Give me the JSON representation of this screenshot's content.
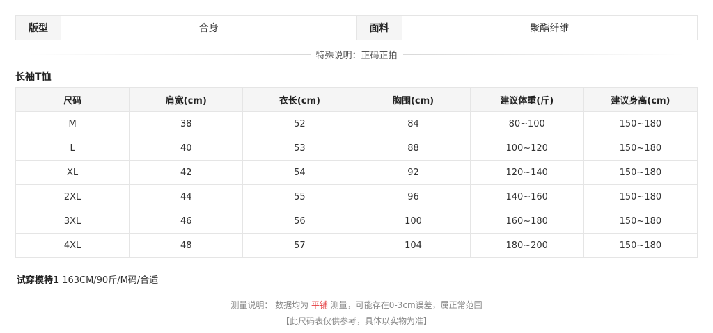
{
  "attributes": {
    "fit_label": "版型",
    "fit_value": "合身",
    "fabric_label": "面料",
    "fabric_value": "聚酯纤维"
  },
  "special_note": "特殊说明：正码正拍",
  "section_title": "长袖T恤",
  "size_table": {
    "headers": [
      "尺码",
      "肩宽(cm)",
      "衣长(cm)",
      "胸围(cm)",
      "建议体重(斤)",
      "建议身高(cm)"
    ],
    "rows": [
      [
        "M",
        "38",
        "52",
        "84",
        "80~100",
        "150~180"
      ],
      [
        "L",
        "40",
        "53",
        "88",
        "100~120",
        "150~180"
      ],
      [
        "XL",
        "42",
        "54",
        "92",
        "120~140",
        "150~180"
      ],
      [
        "2XL",
        "44",
        "55",
        "96",
        "140~160",
        "150~180"
      ],
      [
        "3XL",
        "46",
        "56",
        "100",
        "160~180",
        "150~180"
      ],
      [
        "4XL",
        "48",
        "57",
        "104",
        "180~200",
        "150~180"
      ]
    ]
  },
  "model": {
    "label": "试穿模特1",
    "value": " 163CM/90斤/M码/合适"
  },
  "footer": {
    "measure_prefix": "测量说明：  数据均为 ",
    "measure_highlight": "平铺",
    "measure_suffix": " 测量，可能存在0-3cm误差，属正常范围",
    "reference_note": "【此尺码表仅供参考，具体以实物为准】"
  },
  "colors": {
    "highlight": "#e4393c",
    "header_bg": "#f5f5f5",
    "border": "#e5e5e5"
  }
}
